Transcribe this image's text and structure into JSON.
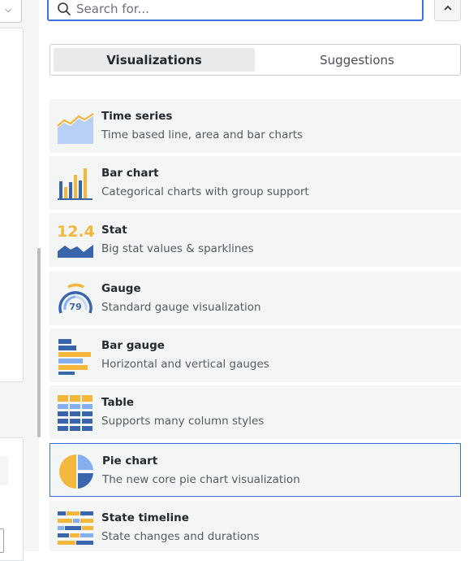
{
  "search": {
    "placeholder": "Search for..."
  },
  "tabs": [
    {
      "label": "Visualizations",
      "active": true
    },
    {
      "label": "Suggestions",
      "active": false
    }
  ],
  "visualizations": [
    {
      "name": "Time series",
      "description": "Time based line, area and bar charts",
      "icon": "time-series-icon"
    },
    {
      "name": "Bar chart",
      "description": "Categorical charts with group support",
      "icon": "bar-chart-icon"
    },
    {
      "name": "Stat",
      "description": "Big stat values & sparklines",
      "icon": "stat-icon",
      "icon_text": "12.4"
    },
    {
      "name": "Gauge",
      "description": "Standard gauge visualization",
      "icon": "gauge-icon",
      "icon_text": "79"
    },
    {
      "name": "Bar gauge",
      "description": "Horizontal and vertical gauges",
      "icon": "bar-gauge-icon"
    },
    {
      "name": "Table",
      "description": "Supports many column styles",
      "icon": "table-icon"
    },
    {
      "name": "Pie chart",
      "description": "The new core pie chart visualization",
      "icon": "pie-chart-icon",
      "selected": true
    },
    {
      "name": "State timeline",
      "description": "State changes and durations",
      "icon": "state-timeline-icon"
    }
  ],
  "colors": {
    "accent": "#3d71d9",
    "yellow": "#f5b73b",
    "blue": "#3865ab",
    "light_blue": "#84aff1"
  }
}
